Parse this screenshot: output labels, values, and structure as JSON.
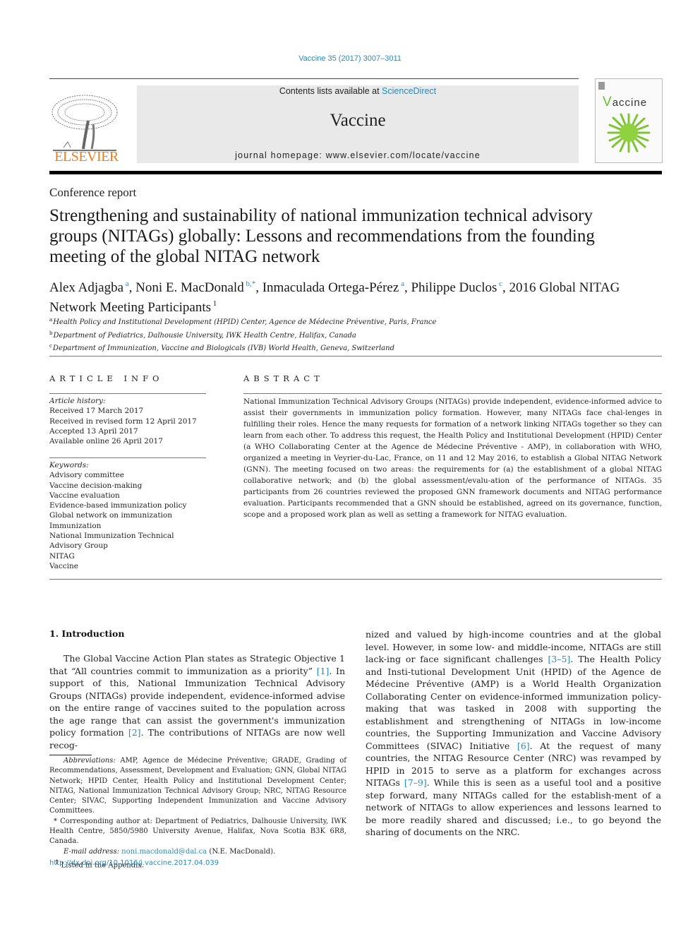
{
  "header": {
    "citation": "Vaccine 35 (2017) 3007–3011",
    "contents_prefix": "Contents lists available at ",
    "contents_link": "ScienceDirect",
    "journal_name": "Vaccine",
    "homepage": "journal homepage: www.elsevier.com/locate/vaccine",
    "publisher_logo_text": "ELSEVIER",
    "cover_title_initial": "V",
    "cover_title_rest": "accine"
  },
  "article": {
    "section_type": "Conference report",
    "title": "Strengthening and sustainability of national immunization technical advisory groups (NITAGs) globally: Lessons and recommendations from the founding meeting of the global NITAG network",
    "authors": [
      {
        "name": "Alex Adjagba",
        "sup": "a"
      },
      {
        "name": "Noni E. MacDonald",
        "sup": "b,*"
      },
      {
        "name": "Inmaculada Ortega-Pérez",
        "sup": "a"
      },
      {
        "name": "Philippe Duclos",
        "sup": "c"
      },
      {
        "name": "2016 Global NITAG Network Meeting Participants",
        "sup": "1"
      }
    ],
    "affiliations": [
      {
        "sup": "a",
        "text": "Health Policy and Institutional Development (HPID) Center, Agence de Médecine Préventive, Paris, France"
      },
      {
        "sup": "b",
        "text": "Department of Pediatrics, Dalhousie University, IWK Health Centre, Halifax, Canada"
      },
      {
        "sup": "c",
        "text": "Department of Immunization, Vaccine and Biologicals (IVB) World Health, Geneva, Switzerland"
      }
    ]
  },
  "article_info": {
    "heading": "ARTICLE INFO",
    "history_label": "Article history:",
    "history": [
      "Received 17 March 2017",
      "Received in revised form 12 April 2017",
      "Accepted 13 April 2017",
      "Available online 26 April 2017"
    ],
    "keywords_label": "Keywords:",
    "keywords": [
      "Advisory committee",
      "Vaccine decision-making",
      "Vaccine evaluation",
      "Evidence-based immunization policy",
      "Global network on immunization",
      "Immunization",
      "National Immunization Technical Advisory Group",
      "NITAG",
      "Vaccine"
    ]
  },
  "abstract": {
    "heading": "ABSTRACT",
    "text": "National Immunization Technical Advisory Groups (NITAGs) provide independent, evidence-informed advice to assist their governments in immunization policy formation. However, many NITAGs face chal-lenges in fulfilling their roles. Hence the many requests for formation of a network linking NITAGs together so they can learn from each other. To address this request, the Health Policy and Institutional Development (HPID) Center (a WHO Collaborating Center at the Agence de Médecine Préventive - AMP), in collaboration with WHO, organized a meeting in Veyrier-du-Lac, France, on 11 and 12 May 2016, to establish a Global NITAG Network (GNN). The meeting focused on two areas: the requirements for (a) the establishment of a global NITAG collaborative network; and (b) the global assessment/evalu-ation of the performance of NITAGs. 35 participants from 26 countries reviewed the proposed GNN framework documents and NITAG performance evaluation. Participants recommended that a GNN should be established, agreed on its governance, function, scope and a proposed work plan as well as setting a framework for NITAG evaluation."
  },
  "introduction": {
    "heading": "1. Introduction",
    "left": [
      {
        "t": "The Global Vaccine Action Plan states as Strategic Objective 1 that “All countries commit to immunization as a priority” "
      },
      {
        "ref": "[1]"
      },
      {
        "t": ". In support of this, National Immunization Technical Advisory Groups (NITAGs) provide independent, evidence-informed advise on the entire range of vaccines suited to the population across the age range that can assist the government's immunization policy formation "
      },
      {
        "ref": "[2]"
      },
      {
        "t": ". The contributions of NITAGs are now well recog-"
      }
    ],
    "right": [
      {
        "t": "nized and valued by high-income countries and at the global level. However, in some low- and middle-income, NITAGs are still lack-ing or face significant challenges "
      },
      {
        "ref": "[3–5]"
      },
      {
        "t": ". The Health Policy and Insti-tutional Development Unit (HPID) of the Agence de Médecine Préventive (AMP) is a World Health Organization Collaborating Center on evidence-informed immunization policy-making that was tasked in 2008 with supporting the establishment and strengthening of NITAGs in low-income countries, the Supporting Immunization and Vaccine Advisory Committees (SIVAC) Initiative "
      },
      {
        "ref": "[6]"
      },
      {
        "t": ". At the request of many countries, the NITAG Resource Center (NRC) was revamped by HPID in 2015 to serve as a platform for exchanges across NITAGs "
      },
      {
        "ref": "[7–9]"
      },
      {
        "t": ". While this is seen as a useful tool and a positive step forward, many NITAGs called for the establish-ment of a network of NITAGs to allow experiences and lessons learned to be more readily shared and discussed; i.e., to go beyond the sharing of documents on the NRC."
      }
    ]
  },
  "footnotes": {
    "abbrev_label": "Abbreviations:",
    "abbrev_text": " AMP, Agence de Médecine Préventive; GRADE, Grading of Recommendations, Assessment, Development and Evaluation; GNN, Global NITAG Network; HPID Center, Health Policy and Institutional Development Center; NITAG, National Immunization Technical Advisory Group; NRC, NITAG Resource Center; SIVAC, Supporting Independent Immunization and Vaccine Advisory Committees.",
    "corresponding": "* Corresponding author at: Department of Pediatrics, Dalhousie University, IWK Health Centre, 5850/5980 University Avenue, Halifax, Nova Scotia B3K 6R8, Canada.",
    "email_label": "E-mail address:",
    "email": "noni.macdonald@dal.ca",
    "email_suffix": " (N.E. MacDonald).",
    "appendix_sup": "1",
    "appendix": " Listed in the Appendix."
  },
  "doi": "http://dx.doi.org/10.1016/j.vaccine.2017.04.039"
}
